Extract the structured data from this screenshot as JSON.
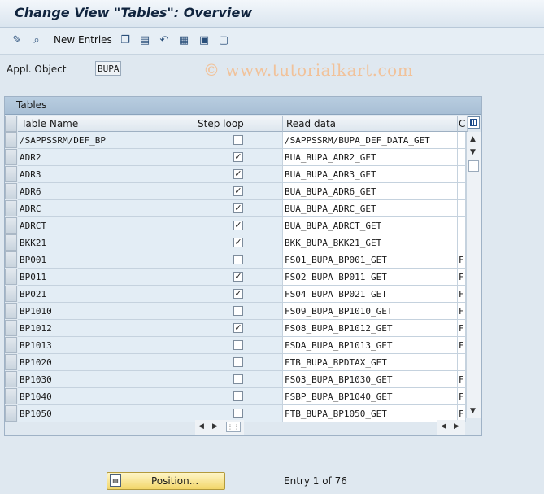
{
  "window": {
    "title": "Change View \"Tables\": Overview"
  },
  "toolbar": {
    "icons": [
      "edit-glasses-icon",
      "find-icon",
      "copy-icon",
      "delete-icon",
      "undo-icon",
      "select-all-icon",
      "select-block-icon",
      "deselect-all-icon"
    ],
    "new_entries_label": "New Entries"
  },
  "watermark": "© www.tutorialkart.com",
  "appl_object": {
    "label": "Appl. Object",
    "value": "BUPA"
  },
  "tables_panel": {
    "title": "Tables",
    "columns": [
      "Table Name",
      "Step loop",
      "Read data",
      "C"
    ],
    "rows": [
      {
        "name": "/SAPPSSRM/DEF_BP",
        "step_loop": false,
        "read_data": "/SAPPSSRM/BUPA_DEF_DATA_GET",
        "c": ""
      },
      {
        "name": "ADR2",
        "step_loop": true,
        "read_data": "BUA_BUPA_ADR2_GET",
        "c": ""
      },
      {
        "name": "ADR3",
        "step_loop": true,
        "read_data": "BUA_BUPA_ADR3_GET",
        "c": ""
      },
      {
        "name": "ADR6",
        "step_loop": true,
        "read_data": "BUA_BUPA_ADR6_GET",
        "c": ""
      },
      {
        "name": "ADRC",
        "step_loop": true,
        "read_data": "BUA_BUPA_ADRC_GET",
        "c": ""
      },
      {
        "name": "ADRCT",
        "step_loop": true,
        "read_data": "BUA_BUPA_ADRCT_GET",
        "c": ""
      },
      {
        "name": "BKK21",
        "step_loop": true,
        "read_data": "BKK_BUPA_BKK21_GET",
        "c": ""
      },
      {
        "name": "BP001",
        "step_loop": false,
        "read_data": "FS01_BUPA_BP001_GET",
        "c": "F"
      },
      {
        "name": "BP011",
        "step_loop": true,
        "read_data": "FS02_BUPA_BP011_GET",
        "c": "F"
      },
      {
        "name": "BP021",
        "step_loop": true,
        "read_data": "FS04_BUPA_BP021_GET",
        "c": "F"
      },
      {
        "name": "BP1010",
        "step_loop": false,
        "read_data": "FS09_BUPA_BP1010_GET",
        "c": "F"
      },
      {
        "name": "BP1012",
        "step_loop": true,
        "read_data": "FS08_BUPA_BP1012_GET",
        "c": "F"
      },
      {
        "name": "BP1013",
        "step_loop": false,
        "read_data": "FSDA_BUPA_BP1013_GET",
        "c": "F"
      },
      {
        "name": "BP1020",
        "step_loop": false,
        "read_data": "FTB_BUPA_BPDTAX_GET",
        "c": ""
      },
      {
        "name": "BP1030",
        "step_loop": false,
        "read_data": "FS03_BUPA_BP1030_GET",
        "c": "F"
      },
      {
        "name": "BP1040",
        "step_loop": false,
        "read_data": "FSBP_BUPA_BP1040_GET",
        "c": "F"
      },
      {
        "name": "BP1050",
        "step_loop": false,
        "read_data": "FTB_BUPA_BP1050_GET",
        "c": "F"
      }
    ]
  },
  "footer": {
    "position_label": "Position...",
    "entry_text": "Entry 1 of 76"
  },
  "colors": {
    "title": "#10243e",
    "panel_header": "#b8cde0",
    "button_yellow": "#f2d66a"
  }
}
